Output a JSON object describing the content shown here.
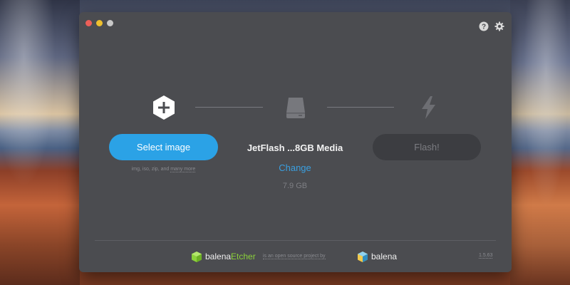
{
  "window": {
    "title": "balenaEtcher"
  },
  "header": {
    "help_icon": "help-circle-icon",
    "settings_icon": "gear-icon"
  },
  "steps": {
    "image": {
      "icon": "plus-hexagon-icon",
      "button_label": "Select image",
      "hint_prefix": "img, iso, zip, and ",
      "hint_more": "many more"
    },
    "drive": {
      "icon": "drive-icon",
      "name": "JetFlash ...8GB Media",
      "change_label": "Change",
      "size": "7.9 GB"
    },
    "flash": {
      "icon": "lightning-bolt-icon",
      "button_label": "Flash!"
    }
  },
  "footer": {
    "brand_part1": "balena",
    "brand_part2": "Etcher",
    "tagline": "is an open source project by",
    "company": "balena",
    "version": "1.5.63"
  },
  "colors": {
    "window_bg": "#4b4c50",
    "primary_button": "#2ba2e6",
    "link": "#3a9fe0",
    "disabled_button": "#3c3d41",
    "etcher_green": "#8bd13a"
  }
}
